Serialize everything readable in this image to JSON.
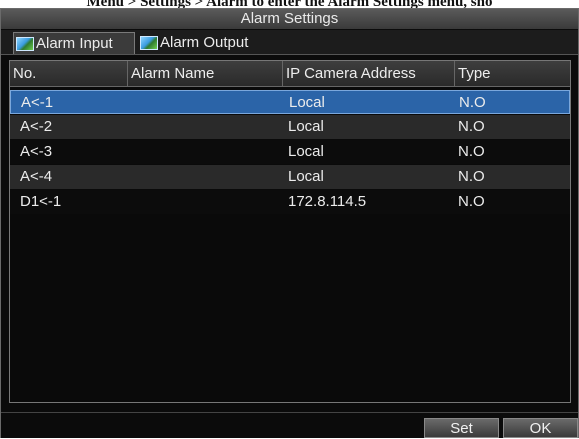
{
  "caption": "Menu > Settings > Alarm to enter the Alarm Settings menu, sho",
  "window": {
    "title": "Alarm Settings"
  },
  "tabs": [
    {
      "label": "Alarm Input",
      "icon": "image-icon"
    },
    {
      "label": "Alarm Output",
      "icon": "image-icon"
    }
  ],
  "table": {
    "columns": [
      "No.",
      "Alarm Name",
      "IP Camera Address",
      "Type"
    ],
    "rows": [
      {
        "no": "A<-1",
        "name": "",
        "address": "Local",
        "type": "N.O",
        "selected": true
      },
      {
        "no": "A<-2",
        "name": "",
        "address": "Local",
        "type": "N.O"
      },
      {
        "no": "A<-3",
        "name": "",
        "address": "Local",
        "type": "N.O"
      },
      {
        "no": "A<-4",
        "name": "",
        "address": "Local",
        "type": "N.O"
      },
      {
        "no": "D1<-1",
        "name": "",
        "address": "172.8.114.5",
        "type": "N.O"
      }
    ]
  },
  "buttons": {
    "set": "Set",
    "ok": "OK"
  },
  "colors": {
    "selected_row": "#2b64a8",
    "window_bg": "#0b0b0b"
  }
}
